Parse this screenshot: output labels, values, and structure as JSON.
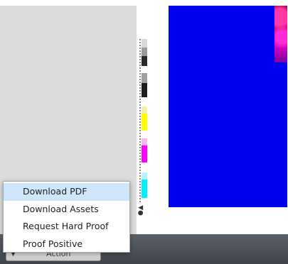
{
  "menu": {
    "items": [
      {
        "label": "Download PDF",
        "active": true
      },
      {
        "label": "Download Assets",
        "active": false
      },
      {
        "label": "Request Hard Proof",
        "active": false
      },
      {
        "label": "Proof Positive",
        "active": false
      }
    ]
  },
  "action_button": {
    "label": "Action"
  },
  "colors": {
    "page": "#0000f0",
    "menu_highlight": "#cfe6fa",
    "panel": "#dcdcdc",
    "bottom_bar": "#4a4e55"
  },
  "color_bar": {
    "patches": [
      "#d9d9d9",
      "#9a9a9a",
      "#2a2a2a",
      "#f2f2a8",
      "#ffff00",
      "#f7b6f0",
      "#ff00ff",
      "#b6f6fb",
      "#00f0ff"
    ]
  },
  "icons": {
    "action_caret": "triangle-down-icon",
    "bar_logo": "registration-logo-icon"
  }
}
